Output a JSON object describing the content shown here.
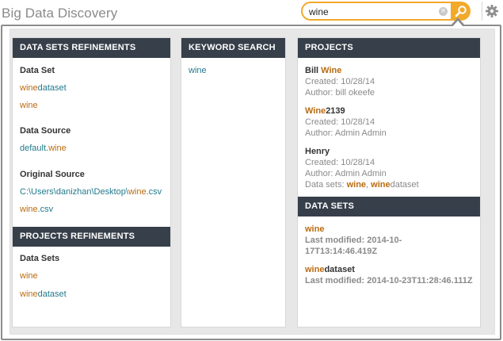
{
  "app": {
    "title": "Big Data Discovery"
  },
  "search": {
    "value": "wine",
    "clear_glyph": "×"
  },
  "icons": {
    "search": "search-icon",
    "settings": "gear-icon",
    "clear": "clear-icon"
  },
  "colors": {
    "accent": "#f2a92a",
    "header_bg": "#373f4a",
    "highlight": "#b96b10",
    "link": "#227a8c",
    "muted": "#8a8a8a"
  },
  "dataset_refinements": {
    "header": "DATA SETS REFINEMENTS",
    "data_set": {
      "title": "Data Set",
      "items": [
        {
          "hl": "wine",
          "rest": "dataset"
        },
        {
          "hl": "wine",
          "rest": ""
        }
      ]
    },
    "data_source": {
      "title": "Data Source",
      "items": [
        {
          "pre": "default.",
          "hl": "wine"
        }
      ]
    },
    "original_source": {
      "title": "Original Source",
      "items": [
        {
          "pre": "C:\\Users\\danizhan\\Desktop\\",
          "hl": "wine",
          "rest": ".csv"
        },
        {
          "pre": "",
          "hl": "wine",
          "rest": ".csv"
        }
      ]
    }
  },
  "projects_refinements": {
    "header": "PROJECTS REFINEMENTS",
    "data_sets": {
      "title": "Data Sets",
      "items": [
        {
          "hl": "wine",
          "rest": ""
        },
        {
          "hl": "wine",
          "rest": "dataset"
        }
      ]
    }
  },
  "keyword_search": {
    "header": "KEYWORD SEARCH",
    "items": [
      "wine"
    ]
  },
  "projects": {
    "header": "PROJECTS",
    "items": [
      {
        "name_pre": "Bill ",
        "name_hl": "Wine",
        "name_rest": "",
        "created": "Created: 10/28/14",
        "author": "Author: bill okeefe"
      },
      {
        "name_pre": "",
        "name_hl": "Wine",
        "name_rest": "2139",
        "created": "Created: 10/28/14",
        "author": "Author: Admin Admin"
      },
      {
        "name_pre": "",
        "name_hl": "",
        "name_rest": "Henry",
        "created": "Created: 10/28/14",
        "author": "Author: Admin Admin",
        "datasets_label": "Data sets: ",
        "ds1": "wine",
        "sep": ", ",
        "ds2_hl": "wine",
        "ds2_rest": "dataset"
      }
    ]
  },
  "data_sets": {
    "header": "DATA SETS",
    "items": [
      {
        "hl": "wine",
        "rest": "",
        "modified": "Last modified: 2014-10-17T13:14:46.419Z"
      },
      {
        "hl": "wine",
        "rest": "dataset",
        "modified": "Last modified: 2014-10-23T11:28:46.111Z"
      }
    ]
  }
}
